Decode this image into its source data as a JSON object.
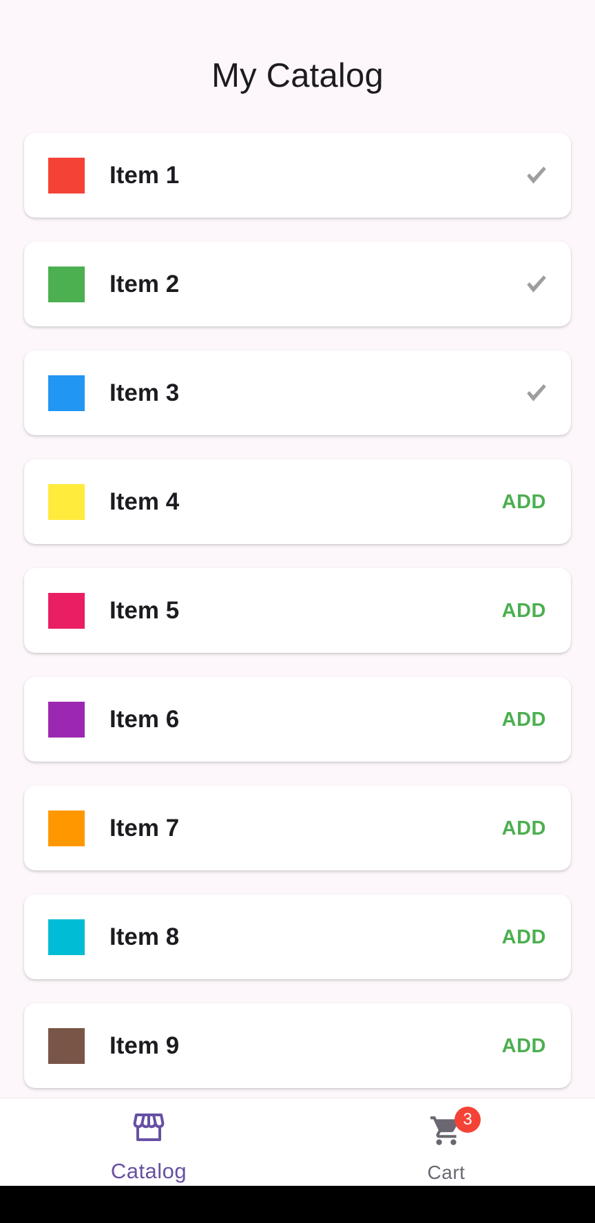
{
  "header": {
    "title": "My Catalog"
  },
  "items": [
    {
      "name": "Item 1",
      "color": "#f44336",
      "in_cart": true,
      "action": "✔"
    },
    {
      "name": "Item 2",
      "color": "#4caf50",
      "in_cart": true,
      "action": "✔"
    },
    {
      "name": "Item 3",
      "color": "#2196f3",
      "in_cart": true,
      "action": "✔"
    },
    {
      "name": "Item 4",
      "color": "#ffeb3b",
      "in_cart": false,
      "action": "ADD"
    },
    {
      "name": "Item 5",
      "color": "#e91e63",
      "in_cart": false,
      "action": "ADD"
    },
    {
      "name": "Item 6",
      "color": "#9c27b0",
      "in_cart": false,
      "action": "ADD"
    },
    {
      "name": "Item 7",
      "color": "#ff9800",
      "in_cart": false,
      "action": "ADD"
    },
    {
      "name": "Item 8",
      "color": "#00bcd4",
      "in_cart": false,
      "action": "ADD"
    },
    {
      "name": "Item 9",
      "color": "#795548",
      "in_cart": false,
      "action": "ADD"
    }
  ],
  "bottom_nav": {
    "catalog": {
      "label": "Catalog",
      "icon": "storefront-icon",
      "selected": true
    },
    "cart": {
      "label": "Cart",
      "icon": "cart-icon",
      "badge": "3"
    }
  },
  "colors": {
    "accent": "#6750a4",
    "add_green": "#4caf50",
    "check_gray": "#9e9e9e",
    "badge_red": "#f44336"
  }
}
